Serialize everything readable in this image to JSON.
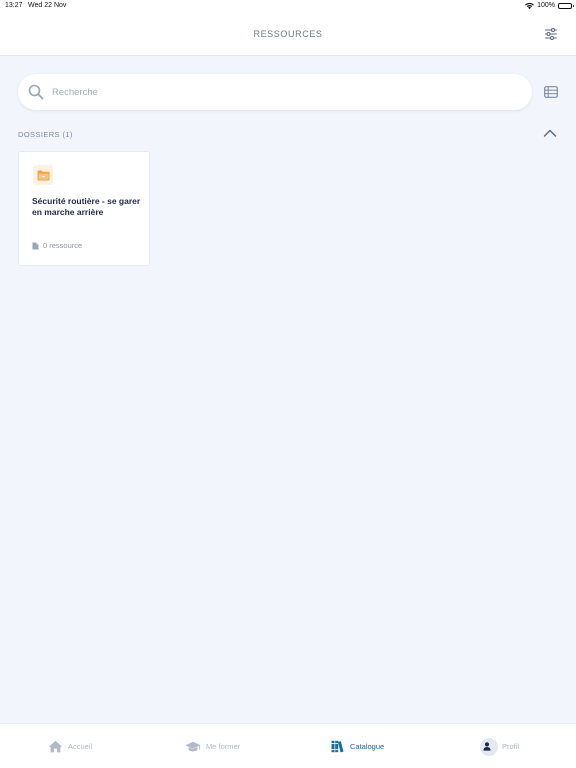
{
  "status_bar": {
    "time": "13:27",
    "date": "Wed 22 Nov",
    "battery": "100%"
  },
  "header": {
    "title": "RESSOURCES"
  },
  "search": {
    "placeholder": "Recherche",
    "value": ""
  },
  "section": {
    "label": "DOSSIERS (1)"
  },
  "folders": [
    {
      "title": "Sécurité routière - se garer en marche arrière",
      "count_label": "0 ressource"
    }
  ],
  "tabbar": {
    "items": [
      {
        "label": "Accueil",
        "icon": "home-icon",
        "active": false
      },
      {
        "label": "Me former",
        "icon": "graduation-cap-icon",
        "active": false
      },
      {
        "label": "Catalogue",
        "icon": "books-icon",
        "active": true
      },
      {
        "label": "Profil",
        "icon": "user-icon",
        "active": false
      }
    ]
  },
  "colors": {
    "accent": "#1c6c9c",
    "background": "#f2f6fc",
    "inactive": "#b1bacb",
    "folder": "#f2a444"
  }
}
